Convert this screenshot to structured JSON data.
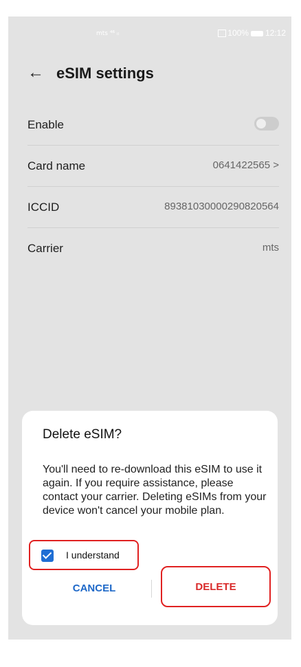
{
  "status_bar": {
    "left_text": "mts ⁴⁶ ᵢₗ",
    "battery": "100%",
    "time": "12:12"
  },
  "header": {
    "title": "eSIM settings"
  },
  "rows": [
    {
      "label": "Enable",
      "value": ""
    },
    {
      "label": "Card name",
      "value": "0641422565 >"
    },
    {
      "label": "ICCID",
      "value": "89381030000290820564"
    },
    {
      "label": "Carrier",
      "value": "mts"
    }
  ],
  "dialog": {
    "title": "Delete eSIM?",
    "body": "You'll need to re-download this eSIM to use it again. If you require assistance, please contact your carrier. Deleting eSIMs from your device won't cancel your mobile plan.",
    "checkbox_label": "I understand",
    "cancel_label": "CANCEL",
    "delete_label": "DELETE"
  },
  "colors": {
    "accent": "#1e68c8",
    "danger": "#d92a2a",
    "highlight": "#e02020"
  }
}
